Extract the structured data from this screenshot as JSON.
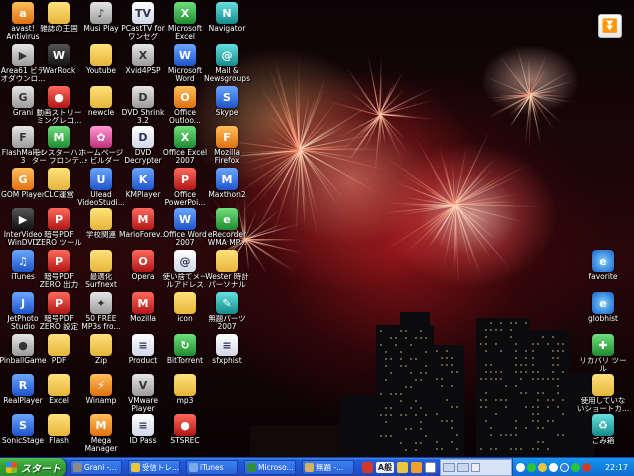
{
  "desktop": {
    "icons": [
      {
        "label": "avast!\nAntivirus",
        "glyph": "a",
        "style": "g-orange",
        "icon": "avast-icon"
      },
      {
        "label": "雑誌の王国",
        "glyph": "",
        "style": "g-folder",
        "icon": "folder-icon"
      },
      {
        "label": "Musi Play",
        "glyph": "♪",
        "style": "g-gray",
        "icon": "music-player-icon"
      },
      {
        "label": "PCastTV for\nワンセグ",
        "glyph": "TV",
        "style": "g-doc",
        "icon": "tv-icon"
      },
      {
        "label": "Microsoft\nExcel",
        "glyph": "X",
        "style": "g-green",
        "icon": "excel-icon"
      },
      {
        "label": "Navigator",
        "glyph": "N",
        "style": "g-teal",
        "icon": "navigator-icon"
      },
      {
        "label": "Area61 ビデ\nオダウンロ...",
        "glyph": "▶",
        "style": "g-gray",
        "icon": "video-download-icon"
      },
      {
        "label": "WarRock",
        "glyph": "W",
        "style": "g-black",
        "icon": "game-icon"
      },
      {
        "label": "Youtube",
        "glyph": "",
        "style": "g-folder",
        "icon": "folder-icon"
      },
      {
        "label": "Xvid4PSP",
        "glyph": "X",
        "style": "g-gray",
        "icon": "converter-icon"
      },
      {
        "label": "Microsoft\nWord",
        "glyph": "W",
        "style": "g-blue",
        "icon": "word-icon"
      },
      {
        "label": "Mail &\nNewsgroups",
        "glyph": "@",
        "style": "g-teal",
        "icon": "mail-icon"
      },
      {
        "label": "Grani",
        "glyph": "G",
        "style": "g-gray",
        "icon": "browser-icon"
      },
      {
        "label": "動画ストリー\nミングレコ...",
        "glyph": "●",
        "style": "g-red",
        "icon": "recorder-icon"
      },
      {
        "label": "newcle",
        "glyph": "",
        "style": "g-folder",
        "icon": "folder-icon"
      },
      {
        "label": "DVD Shrink\n3.2",
        "glyph": "D",
        "style": "g-gray",
        "icon": "dvd-icon"
      },
      {
        "label": "Office\nOutloo...",
        "glyph": "O",
        "style": "g-orange",
        "icon": "outlook-icon"
      },
      {
        "label": "Skype",
        "glyph": "S",
        "style": "g-blue",
        "icon": "skype-icon"
      },
      {
        "label": "FlashMaker\n3",
        "glyph": "F",
        "style": "g-gray",
        "icon": "flash-icon"
      },
      {
        "label": "モンスターハン\nター フロンテ...",
        "glyph": "M",
        "style": "g-green",
        "icon": "game-icon"
      },
      {
        "label": "ホームページ\n・ビルダー",
        "glyph": "✿",
        "style": "g-pink",
        "icon": "homepage-builder-icon"
      },
      {
        "label": "DVD\nDecrypter",
        "glyph": "D",
        "style": "g-doc",
        "icon": "dvd-icon"
      },
      {
        "label": "Office Excel\n2007",
        "glyph": "X",
        "style": "g-green",
        "icon": "excel-icon"
      },
      {
        "label": "Mozilla\nFirefox",
        "glyph": "F",
        "style": "g-orange",
        "icon": "firefox-icon"
      },
      {
        "label": "GOM Player",
        "glyph": "G",
        "style": "g-orange",
        "icon": "media-player-icon"
      },
      {
        "label": "CLC運営",
        "glyph": "",
        "style": "g-folder",
        "icon": "folder-icon"
      },
      {
        "label": "Ulead\nVideoStudi...",
        "glyph": "U",
        "style": "g-blue",
        "icon": "video-editor-icon"
      },
      {
        "label": "KMPlayer",
        "glyph": "K",
        "style": "g-blue",
        "icon": "media-player-icon"
      },
      {
        "label": "Office\nPowerPoi...",
        "glyph": "P",
        "style": "g-red",
        "icon": "powerpoint-icon"
      },
      {
        "label": "Maxthon2",
        "glyph": "M",
        "style": "g-blue",
        "icon": "browser-icon"
      },
      {
        "label": "InterVideo\nWinDVD",
        "glyph": "▶",
        "style": "g-black",
        "icon": "dvd-player-icon"
      },
      {
        "label": "暗号PDF\nZERO ツール",
        "glyph": "P",
        "style": "g-red",
        "icon": "pdf-icon"
      },
      {
        "label": "学校関連",
        "glyph": "",
        "style": "g-folder",
        "icon": "folder-icon"
      },
      {
        "label": "MarioForev...",
        "glyph": "M",
        "style": "g-red",
        "icon": "game-icon"
      },
      {
        "label": "Office Word\n2007",
        "glyph": "W",
        "style": "g-blue",
        "icon": "word-icon"
      },
      {
        "label": "eRecorder\nWMA MP...",
        "glyph": "e",
        "style": "g-green",
        "icon": "recorder-icon"
      },
      {
        "label": "iTunes",
        "glyph": "♫",
        "style": "g-blue",
        "icon": "itunes-icon"
      },
      {
        "label": "暗号PDF\nZERO 出力",
        "glyph": "P",
        "style": "g-red",
        "icon": "pdf-icon"
      },
      {
        "label": "最適化\nSurfnext",
        "glyph": "",
        "style": "g-folder",
        "icon": "folder-icon"
      },
      {
        "label": "Opera",
        "glyph": "O",
        "style": "g-red",
        "icon": "opera-icon"
      },
      {
        "label": "使い捨てメー\nルアドレス",
        "glyph": "@",
        "style": "g-doc",
        "icon": "document-icon"
      },
      {
        "label": "Wester 時計\nパーソナル",
        "glyph": "",
        "style": "g-folder",
        "icon": "folder-icon"
      },
      {
        "label": "JetPhoto\nStudio",
        "glyph": "J",
        "style": "g-blue",
        "icon": "photo-icon"
      },
      {
        "label": "暗号PDF\nZERO 設定",
        "glyph": "P",
        "style": "g-red",
        "icon": "pdf-icon"
      },
      {
        "label": "50 FREE\nMP3s fro...",
        "glyph": "✦",
        "style": "g-gray",
        "icon": "mp3-icon"
      },
      {
        "label": "Mozilla",
        "glyph": "M",
        "style": "g-red",
        "icon": "mozilla-icon"
      },
      {
        "label": "icon",
        "glyph": "",
        "style": "g-folder",
        "icon": "folder-icon"
      },
      {
        "label": "無題パーツ\n2007",
        "glyph": "✎",
        "style": "g-teal",
        "icon": "editor-icon"
      },
      {
        "label": "PinballGame",
        "glyph": "●",
        "style": "g-gray",
        "icon": "pinball-icon"
      },
      {
        "label": "PDF",
        "glyph": "",
        "style": "g-folder",
        "icon": "folder-icon"
      },
      {
        "label": "Zip",
        "glyph": "",
        "style": "g-folder",
        "icon": "folder-icon"
      },
      {
        "label": "Product",
        "glyph": "≡",
        "style": "g-doc",
        "icon": "document-icon"
      },
      {
        "label": "BitTorrent",
        "glyph": "↻",
        "style": "g-green",
        "icon": "bittorrent-icon"
      },
      {
        "label": "sfxphist",
        "glyph": "≡",
        "style": "g-doc",
        "icon": "document-icon"
      },
      {
        "label": "RealPlayer",
        "glyph": "R",
        "style": "g-blue",
        "icon": "realplayer-icon"
      },
      {
        "label": "Excel",
        "glyph": "",
        "style": "g-folder",
        "icon": "folder-icon"
      },
      {
        "label": "Winamp",
        "glyph": "⚡",
        "style": "g-orange",
        "icon": "winamp-icon"
      },
      {
        "label": "VMware\nPlayer",
        "glyph": "V",
        "style": "g-gray",
        "icon": "vmware-icon"
      },
      {
        "label": "mp3",
        "glyph": "",
        "style": "g-folder",
        "icon": "folder-icon"
      },
      {
        "label": "SonicStage",
        "glyph": "S",
        "style": "g-blue",
        "icon": "sonicstage-icon"
      },
      {
        "label": "Flash",
        "glyph": "",
        "style": "g-folder",
        "icon": "folder-icon"
      },
      {
        "label": "Mega\nManager",
        "glyph": "M",
        "style": "g-orange",
        "icon": "mega-manager-icon"
      },
      {
        "label": "ID Pass",
        "glyph": "≡",
        "style": "g-doc",
        "icon": "document-icon"
      },
      {
        "label": "STSREC",
        "glyph": "●",
        "style": "g-red",
        "icon": "recorder-icon"
      }
    ],
    "right_icons": [
      {
        "label": "favorite",
        "glyph": "e",
        "style": "g-ie",
        "icon": "internet-shortcut-icon"
      },
      {
        "label": "globhist",
        "glyph": "e",
        "style": "g-ie",
        "icon": "internet-shortcut-icon"
      },
      {
        "label": "リカバリ ツー\nル",
        "glyph": "✚",
        "style": "g-green",
        "icon": "recovery-tool-icon"
      },
      {
        "label": "使用していな\nいショートカ...",
        "glyph": "",
        "style": "g-folder",
        "icon": "folder-icon"
      },
      {
        "label": "ごみ箱",
        "glyph": "♻",
        "style": "g-teal",
        "icon": "recycle-bin-icon"
      }
    ]
  },
  "corner_button": {
    "glyph": "⏬",
    "icon": "download-arrow-icon"
  },
  "taskbar": {
    "start_label": "スタート",
    "tasks": [
      {
        "label": "Grani -...",
        "color": "#8a8a8a",
        "icon": "browser-icon"
      },
      {
        "label": "受信トレ...",
        "color": "#e8c640",
        "icon": "mail-icon"
      },
      {
        "label": "iTunes",
        "color": "#7aa8e8",
        "icon": "itunes-icon"
      },
      {
        "label": "Microso...",
        "color": "#2f8f3f",
        "icon": "excel-icon"
      },
      {
        "label": "無題 -...",
        "color": "#d9b060",
        "icon": "editor-icon"
      }
    ],
    "language_bar": "A般",
    "clock": "22:17"
  },
  "colors": {
    "taskbar": "#245ddb",
    "start": "#34a034",
    "tray": "#0f7fe0"
  }
}
